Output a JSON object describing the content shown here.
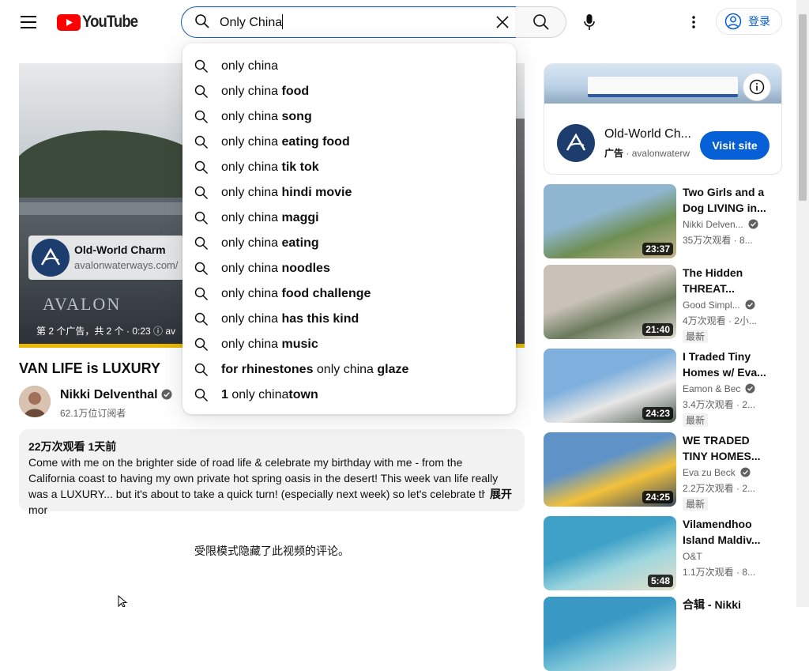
{
  "header": {
    "logo_text": "YouTube",
    "search_value": "Only China",
    "signin_label": "登录"
  },
  "suggestions": [
    {
      "prefix": "only china",
      "suffix": ""
    },
    {
      "prefix": "only china ",
      "suffix": "food"
    },
    {
      "prefix": "only china ",
      "suffix": "song"
    },
    {
      "prefix": "only china ",
      "suffix": "eating food"
    },
    {
      "prefix": "only china ",
      "suffix": "tik tok"
    },
    {
      "prefix": "only china ",
      "suffix": "hindi movie"
    },
    {
      "prefix": "only china ",
      "suffix": "maggi"
    },
    {
      "prefix": "only china ",
      "suffix": "eating"
    },
    {
      "prefix": "only china ",
      "suffix": "noodles"
    },
    {
      "prefix": "only china ",
      "suffix": "food challenge"
    },
    {
      "prefix": "only china ",
      "suffix": "has this kind"
    },
    {
      "prefix": "only china ",
      "suffix": "music"
    },
    {
      "lead": "for rhinestones ",
      "prefix": "only china",
      "suffix": " glaze"
    },
    {
      "lead": "1 ",
      "prefix": "only china",
      "suffix": "town"
    }
  ],
  "player": {
    "ad_title": "Old-World Charm",
    "ad_url": "avalonwaterways.com/",
    "brand_mark": "AVALON",
    "ad_count": "第 2 个广告，共 2 个 · 0:23 ⓘ  av"
  },
  "video": {
    "title": "VAN LIFE is LUXURY",
    "channel": "Nikki Delventhal",
    "subscribers": "62.1万位订阅者",
    "views_date": "22万次观看  1天前",
    "description": "Come with me on the brighter side of road life & celebrate my birthday with me - from the California coast to having my own private hot spring oasis in the desert! This week van life really was a LUXURY... but it's about to take a quick turn! (especially next week) so let's celebrate the mor",
    "more_label": "展开",
    "comments_disabled": "受限模式隐藏了此视频的评论。"
  },
  "sidebar_ad": {
    "title": "Old-World Ch...",
    "label": "广告",
    "domain": "avalonwaterw",
    "button": "Visit site"
  },
  "recommendations": [
    {
      "title": "Two Girls and a Dog LIVING in...",
      "channel": "Nikki Delven...",
      "meta": "35万次观看 · 8...",
      "duration": "23:37",
      "badge": "",
      "verified": true,
      "colors": [
        "#8fb6d1",
        "#6e8f54",
        "#c9b48e"
      ]
    },
    {
      "title": "The Hidden THREAT...",
      "channel": "Good Simpl...",
      "meta": "4万次观看 · 2小...",
      "duration": "21:40",
      "badge": "最新",
      "verified": true,
      "colors": [
        "#c9c2b8",
        "#6a7a5c",
        "#e6e0d6"
      ]
    },
    {
      "title": "I Traded Tiny Homes w/ Eva...",
      "channel": "Eamon & Bec",
      "meta": "3.4万次观看 · 2...",
      "duration": "24:23",
      "badge": "最新",
      "verified": true,
      "colors": [
        "#7fb0dd",
        "#e7e7e7",
        "#4d5b4d"
      ]
    },
    {
      "title": "WE TRADED TINY HOMES...",
      "channel": "Eva zu Beck",
      "meta": "2.2万次观看 · 2...",
      "duration": "24:25",
      "badge": "最新",
      "verified": true,
      "colors": [
        "#5f93c8",
        "#f3c13a",
        "#3b4b63"
      ]
    },
    {
      "title": "Vilamendhoo Island Maldiv...",
      "channel": "O&T",
      "meta": "1.1万次观看 · 8...",
      "duration": "5:48",
      "badge": "",
      "verified": false,
      "colors": [
        "#3fa1c8",
        "#9ed6de",
        "#e7e0c9"
      ]
    },
    {
      "title": "合辑 - Nikki",
      "channel": "",
      "meta": "",
      "duration": "",
      "badge": "",
      "verified": false,
      "colors": [
        "#3a9ac5",
        "#7fc6d9",
        "#d7e5e8"
      ]
    }
  ]
}
